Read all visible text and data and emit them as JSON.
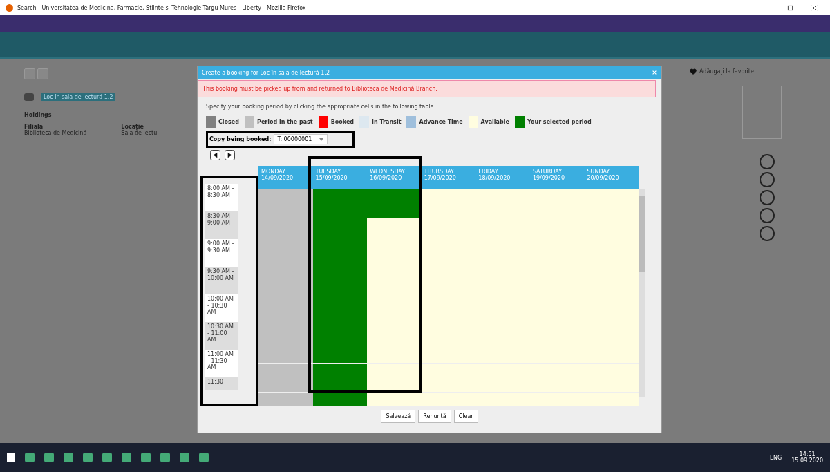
{
  "window": {
    "title": "Search - Universitatea de Medicina, Farmacie, Stiinte si Tehnologie Targu Mures - Liberty - Mozilla Firefox"
  },
  "background_page": {
    "record_title": "Loc în sala de lectură 1.2",
    "section": "Holdings",
    "columns": [
      {
        "label": "Filială",
        "value": "Biblioteca de Medicină"
      },
      {
        "label": "Locație",
        "value": "Sala de lectu"
      }
    ],
    "favourite": "Adăugați la favorite"
  },
  "dialog": {
    "title": "Create a booking for Loc în sala de lectură 1.2",
    "alert": "This booking must be picked up from and returned to Biblioteca de Medicină Branch.",
    "instruction": "Specify your booking period by clicking the appropriate cells in the following table.",
    "legend": [
      {
        "label": "Closed",
        "color": "#808080"
      },
      {
        "label": "Period in the past",
        "color": "#c0c0c0"
      },
      {
        "label": "Booked",
        "color": "#ff0000"
      },
      {
        "label": "In Transit",
        "color": "#dde8f0"
      },
      {
        "label": "Advance Time",
        "color": "#9fbfdc"
      },
      {
        "label": "Available",
        "color": "#fffde0"
      },
      {
        "label": "Your selected period",
        "color": "#008000"
      }
    ],
    "copy_label": "Copy being booked:",
    "copy_value": "T: 00000001",
    "days": [
      {
        "name": "MONDAY",
        "date": "14/09/2020"
      },
      {
        "name": "TUESDAY",
        "date": "15/09/2020"
      },
      {
        "name": "WEDNESDAY",
        "date": "16/09/2020"
      },
      {
        "name": "THURSDAY",
        "date": "17/09/2020"
      },
      {
        "name": "FRIDAY",
        "date": "18/09/2020"
      },
      {
        "name": "SATURDAY",
        "date": "19/09/2020"
      },
      {
        "name": "SUNDAY",
        "date": "20/09/2020"
      }
    ],
    "slots": [
      {
        "time": "8:00 AM - 8:30 AM",
        "cells": [
          {
            "past": true,
            "selected": false
          },
          {
            "past": false,
            "selected": true
          },
          {
            "past": false,
            "selected": true
          },
          {
            "past": false,
            "selected": false
          },
          {
            "past": false,
            "selected": false
          },
          {
            "past": false,
            "selected": false
          },
          {
            "past": false,
            "selected": false
          }
        ]
      },
      {
        "time": "8:30 AM - 9:00 AM",
        "cells": [
          {
            "past": true,
            "selected": false
          },
          {
            "past": false,
            "selected": true
          },
          {
            "past": false,
            "selected": false
          },
          {
            "past": false,
            "selected": false
          },
          {
            "past": false,
            "selected": false
          },
          {
            "past": false,
            "selected": false
          },
          {
            "past": false,
            "selected": false
          }
        ]
      },
      {
        "time": "9:00 AM - 9:30 AM",
        "cells": [
          {
            "past": true,
            "selected": false
          },
          {
            "past": false,
            "selected": true
          },
          {
            "past": false,
            "selected": false
          },
          {
            "past": false,
            "selected": false
          },
          {
            "past": false,
            "selected": false
          },
          {
            "past": false,
            "selected": false
          },
          {
            "past": false,
            "selected": false
          }
        ]
      },
      {
        "time": "9:30 AM - 10:00 AM",
        "cells": [
          {
            "past": true,
            "selected": false
          },
          {
            "past": false,
            "selected": true
          },
          {
            "past": false,
            "selected": false
          },
          {
            "past": false,
            "selected": false
          },
          {
            "past": false,
            "selected": false
          },
          {
            "past": false,
            "selected": false
          },
          {
            "past": false,
            "selected": false
          }
        ]
      },
      {
        "time": "10:00 AM - 10:30 AM",
        "cells": [
          {
            "past": true,
            "selected": false
          },
          {
            "past": false,
            "selected": true
          },
          {
            "past": false,
            "selected": false
          },
          {
            "past": false,
            "selected": false
          },
          {
            "past": false,
            "selected": false
          },
          {
            "past": false,
            "selected": false
          },
          {
            "past": false,
            "selected": false
          }
        ]
      },
      {
        "time": "10:30 AM - 11:00 AM",
        "cells": [
          {
            "past": true,
            "selected": false
          },
          {
            "past": false,
            "selected": true
          },
          {
            "past": false,
            "selected": false
          },
          {
            "past": false,
            "selected": false
          },
          {
            "past": false,
            "selected": false
          },
          {
            "past": false,
            "selected": false
          },
          {
            "past": false,
            "selected": false
          }
        ]
      },
      {
        "time": "11:00 AM - 11:30 AM",
        "cells": [
          {
            "past": true,
            "selected": false
          },
          {
            "past": false,
            "selected": true
          },
          {
            "past": false,
            "selected": false
          },
          {
            "past": false,
            "selected": false
          },
          {
            "past": false,
            "selected": false
          },
          {
            "past": false,
            "selected": false
          },
          {
            "past": false,
            "selected": false
          }
        ]
      },
      {
        "time": "11:30",
        "cells": [
          {
            "past": true,
            "selected": false
          },
          {
            "past": false,
            "selected": true
          },
          {
            "past": false,
            "selected": false
          },
          {
            "past": false,
            "selected": false
          },
          {
            "past": false,
            "selected": false
          },
          {
            "past": false,
            "selected": false
          },
          {
            "past": false,
            "selected": false
          }
        ]
      }
    ],
    "buttons": [
      "Salvează",
      "Renunță",
      "Clear"
    ]
  },
  "taskbar": {
    "time": "14:51",
    "date": "15.09.2020",
    "language": "ENG"
  }
}
